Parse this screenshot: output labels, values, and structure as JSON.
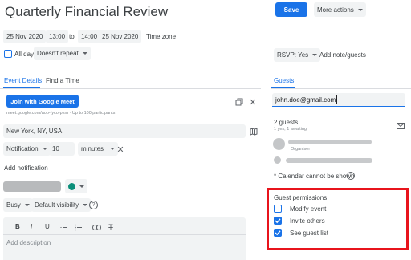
{
  "event": {
    "title": "Quarterly Financial Review",
    "start_date": "25 Nov 2020",
    "start_time": "13:00",
    "to_label": "to",
    "end_time": "14:00",
    "end_date": "25 Nov 2020",
    "timezone_label": "Time zone",
    "all_day_label": "All day",
    "repeat_value": "Doesn't repeat"
  },
  "header": {
    "save_label": "Save",
    "more_actions_label": "More actions",
    "rsvp_value": "RSVP: Yes",
    "add_note_label": "Add note/guests"
  },
  "tabs": {
    "event_details": "Event Details",
    "find_time": "Find a Time",
    "guests": "Guests"
  },
  "meet": {
    "join_label": "Join with Google Meet",
    "link_text": "meet.google.com/aoo-fyco-pkm · Up to 100 participants"
  },
  "location": {
    "value": "New York, NY, USA"
  },
  "notification": {
    "type_value": "Notification",
    "amount_value": "10",
    "unit_value": "minutes",
    "add_label": "Add notification"
  },
  "status": {
    "busy_value": "Busy",
    "visibility_value": "Default visibility"
  },
  "editor": {
    "toolbar": [
      "B",
      "I",
      "U"
    ],
    "description_placeholder": "Add description"
  },
  "guests": {
    "input_value": "john.doe@gmail.com",
    "count_label": "2 guests",
    "count_detail": "1 yes, 1 awaiting",
    "organiser_label": "Organiser",
    "calendar_note": "* Calendar cannot be shown",
    "permissions_title": "Guest permissions",
    "permissions": [
      {
        "label": "Modify event",
        "checked": false
      },
      {
        "label": "Invite others",
        "checked": true
      },
      {
        "label": "See guest list",
        "checked": true
      }
    ]
  },
  "colors": {
    "accent": "#1a73e8",
    "highlight_box": "#e8141c",
    "event_color": "#0b8f7a"
  }
}
